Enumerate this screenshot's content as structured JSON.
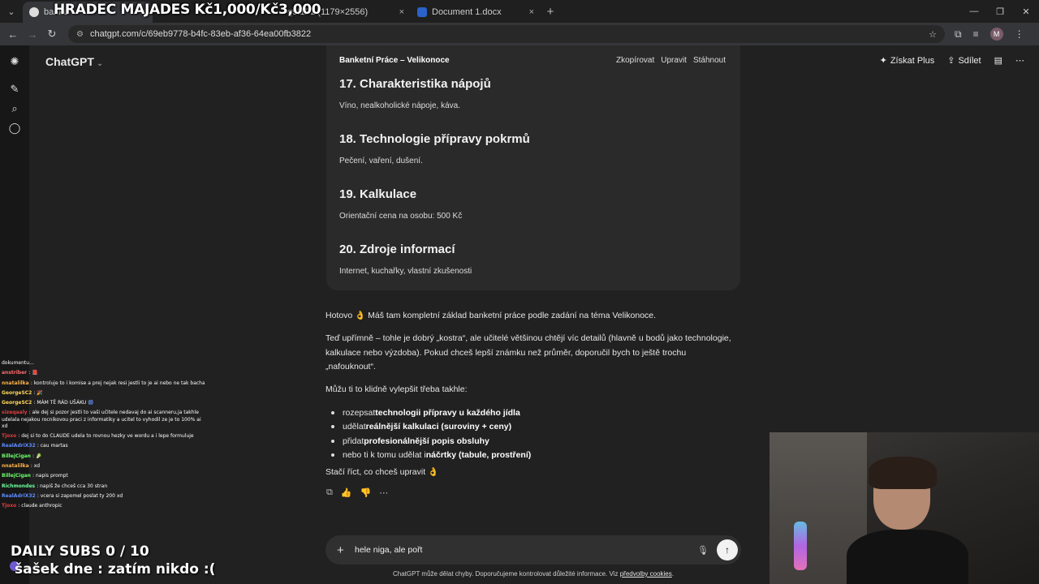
{
  "overlay": {
    "top_title": "HRADEC MAJADES Kč1,000/Kč3,000",
    "daily_subs": "DAILY SUBS 0 / 10",
    "sasek": "šašek dne : zatím nikdo :("
  },
  "browser": {
    "tabs": [
      {
        "label": "banke",
        "icon": "chatgpt-icon",
        "close": "×"
      },
      {
        "label": "q9f1Pz (1179×2556)",
        "icon": "image-icon",
        "close": "×"
      },
      {
        "label": "Document 1.docx",
        "icon": "word-icon",
        "close": "×"
      }
    ],
    "new_tab": "+",
    "url": "chatgpt.com/c/69eb9778-b4fc-83eb-af36-64ea00fb3822",
    "profile_initial": "M"
  },
  "app": {
    "model_name": "ChatGPT",
    "top_actions": {
      "plus": "Získat Plus",
      "share": "Sdílet"
    }
  },
  "canvas": {
    "title": "Banketní Práce – Velikonoce",
    "actions": [
      "Zkopírovat",
      "Upravit",
      "Stáhnout"
    ],
    "sections": [
      {
        "heading": "17. Charakteristika nápojů",
        "text": "Víno, nealkoholické nápoje, káva."
      },
      {
        "heading": "18. Technologie přípravy pokrmů",
        "text": "Pečení, vaření, dušení."
      },
      {
        "heading": "19. Kalkulace",
        "text": "Orientační cena na osobu: 500 Kč"
      },
      {
        "heading": "20. Zdroje informací",
        "text": "Internet, kuchařky, vlastní zkušenosti"
      }
    ]
  },
  "message": {
    "p1": "Hotovo 👌 Máš tam kompletní základ banketní práce podle zadání na téma Velikonoce.",
    "p2_line1": "Teď upřímně – tohle je dobrý „kostra“, ale učitelé většinou chtějí víc detailů (hlavně u bodů jako technologie,",
    "p2_line2": "kalkulace nebo výzdoba). Pokud chceš lepší známku než průměr, doporučil bych to ještě trochu",
    "p2_line3": "„nafouknout“.",
    "p3": "Můžu ti to klidně vylepšit třeba takhle:",
    "bullets": [
      {
        "pre": "rozepsat ",
        "bold": "technologii přípravy u každého jídla"
      },
      {
        "pre": "udělat ",
        "bold": "reálnější kalkulaci (suroviny + ceny)"
      },
      {
        "pre": "přidat ",
        "bold": "profesionálnější popis obsluhy"
      },
      {
        "pre": "nebo ti k tomu udělat i ",
        "bold": "náčrtky (tabule, prostření)"
      }
    ],
    "p4": "Stačí říct, co chceš upravit 👌"
  },
  "composer": {
    "text": "hele niga, ale pořt",
    "disclaimer": "ChatGPT může dělat chyby. Doporučujeme kontrolovat důležité informace. Viz ",
    "disclaimer_link": "předvolby cookies",
    "disclaimer_end": "."
  },
  "chat_overlay": [
    {
      "user": "",
      "text": "dokumentu...",
      "color": "#ffffff"
    },
    {
      "user": "anstriber",
      "text": ": 📕",
      "color": "#ff6b6b"
    },
    {
      "user": "nnatalilka",
      "text": ": kontroluje to i komise a prej nejak resi jestli to je ai nebo ne tak bacha",
      "color": "#ffb347"
    },
    {
      "user": "GeorgeSC2",
      "text": ": 🎉",
      "color": "#ffd75a"
    },
    {
      "user": "GeorgeSC2",
      "text": ": MÁM TĚ RÁD UŠÁKU 🎆",
      "color": "#ffd75a"
    },
    {
      "user": "sizeqaaly",
      "text": ": ale dej si pozor jestli to vaši učitele nedavaj do ai scanneru,ja takhle udelala nejakou rocnikovou praci z informatiky a ucitel to vyhodil ze je to 100% ai xd",
      "color": "#e33d3d",
      "wrap": true
    },
    {
      "user": "Tjoxo",
      "text": ": dej si to do CLAUDE udela to rovnou hezky ve wordu a i lepe formuluje",
      "color": "#e33d3d"
    },
    {
      "user": "RealAdriX32",
      "text": ": cau martas",
      "color": "#5b8cff"
    },
    {
      "user": "BillejCigan",
      "text": ": 🥬",
      "color": "#6cff6c"
    },
    {
      "user": "nnatalilka",
      "text": ": xd",
      "color": "#ffb347"
    },
    {
      "user": "BillejCigan",
      "text": ": napis prompt",
      "color": "#6cff6c"
    },
    {
      "user": "Richmondes",
      "text": ": napiš že chceš cca 30 stran",
      "color": "#6cff9c"
    },
    {
      "user": "RealAdriX32",
      "text": ": vcera si zapomel poslat ty 200 xd",
      "color": "#5b8cff"
    },
    {
      "user": "Tjoxo",
      "text": ": claude anthropic",
      "color": "#e33d3d"
    }
  ]
}
